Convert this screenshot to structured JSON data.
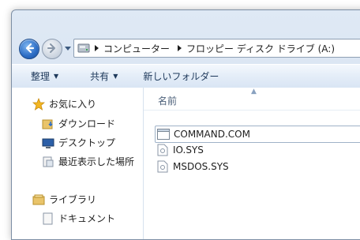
{
  "address": {
    "crumbs": [
      "コンピューター",
      "フロッピー ディスク ドライブ (A:)"
    ],
    "icons": {
      "location": "floppy-drive-icon",
      "separator": "chevron-right-icon"
    }
  },
  "navigation": {
    "back_icon": "back-arrow-icon",
    "forward_icon": "forward-arrow-icon",
    "history_icon": "chevron-down-icon"
  },
  "toolbar": {
    "organize_label": "整理",
    "share_label": "共有",
    "new_folder_label": "新しいフォルダー"
  },
  "sidebar": {
    "favorites": {
      "label": "お気に入り",
      "icon": "star-icon",
      "items": [
        {
          "label": "ダウンロード",
          "icon": "downloads-folder-icon"
        },
        {
          "label": "デスクトップ",
          "icon": "desktop-icon"
        },
        {
          "label": "最近表示した場所",
          "icon": "recent-places-icon"
        }
      ]
    },
    "libraries": {
      "label": "ライブラリ",
      "icon": "library-icon",
      "items": [
        {
          "label": "ドキュメント",
          "icon": "documents-icon"
        }
      ]
    }
  },
  "content": {
    "column_header": "名前",
    "files": [
      {
        "name": "COMMAND.COM",
        "icon": "application-icon"
      },
      {
        "name": "IO.SYS",
        "icon": "system-file-icon"
      },
      {
        "name": "MSDOS.SYS",
        "icon": "system-file-icon"
      }
    ]
  }
}
